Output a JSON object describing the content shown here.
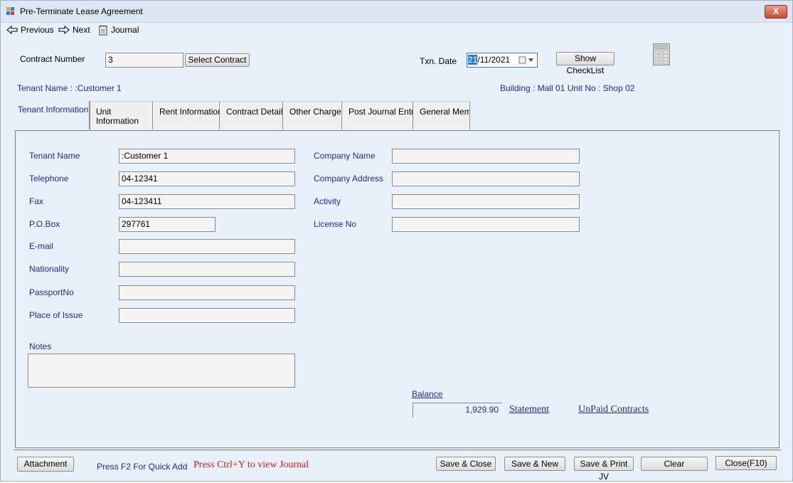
{
  "window": {
    "title": "Pre-Terminate Lease Agreement",
    "close_label": "X"
  },
  "toolbar": {
    "previous": "Previous",
    "next": "Next",
    "journal": "Journal"
  },
  "contract": {
    "number_label": "Contract Number",
    "number_value": "3",
    "select_button": "Select Contract",
    "txn_date_label": "Txn. Date",
    "txn_date_day": "21",
    "txn_date_rest": "/11/2021",
    "checklist_button": "Show CheckList"
  },
  "info": {
    "tenant_name": "Tenant Name : :Customer 1",
    "building_unit": "Building : Mall 01  Unit No : Shop 02"
  },
  "tabs": [
    {
      "line1": "Tenant Information",
      "line2": ""
    },
    {
      "line1": "Unit",
      "line2": "Information"
    },
    {
      "line1": "Rent Information",
      "line2": ""
    },
    {
      "line1": "Contract Details",
      "line2": ""
    },
    {
      "line1": "Other Charges",
      "line2": ""
    },
    {
      "line1": "Post Journal Entry",
      "line2": ""
    },
    {
      "line1": "General Memo",
      "line2": ""
    }
  ],
  "tenant": {
    "name_label": "Tenant Name",
    "name_value": ":Customer 1",
    "telephone_label": "Telephone",
    "telephone_value": "04-12341",
    "fax_label": "Fax",
    "fax_value": "04-123411",
    "pobox_label": "P.O.Box",
    "pobox_value": "297761",
    "email_label": "E-mail",
    "email_value": "",
    "nationality_label": "Nationality",
    "nationality_value": "",
    "passport_label": "PassportNo",
    "passport_value": "",
    "place_label": "Place of Issue",
    "place_value": "",
    "notes_label": "Notes",
    "notes_value": ""
  },
  "company": {
    "name_label": "Company Name",
    "name_value": "",
    "address_label": "Company Address",
    "address_value": "",
    "activity_label": "Activity",
    "activity_value": "",
    "license_label": "License No",
    "license_value": ""
  },
  "balance": {
    "label": "Balance",
    "value": "1,929.90",
    "statement_link": "Statement",
    "unpaid_link": "UnPaid Contracts"
  },
  "footer": {
    "attachment": "Attachment",
    "f2_hint": "Press F2 For Quick Add",
    "ctrl_hint": "Press Ctrl+Y to view Journal",
    "save_close": "Save & Close",
    "save_new": "Save & New",
    "save_print": "Save & Print JV",
    "clear": "Clear",
    "close": "Close(F10)"
  },
  "colors": {
    "label_blue": "#1c2e9c",
    "hint_red": "#d11a1a",
    "window_bg": "#e8f0f8",
    "close_red": "#c84a35"
  }
}
